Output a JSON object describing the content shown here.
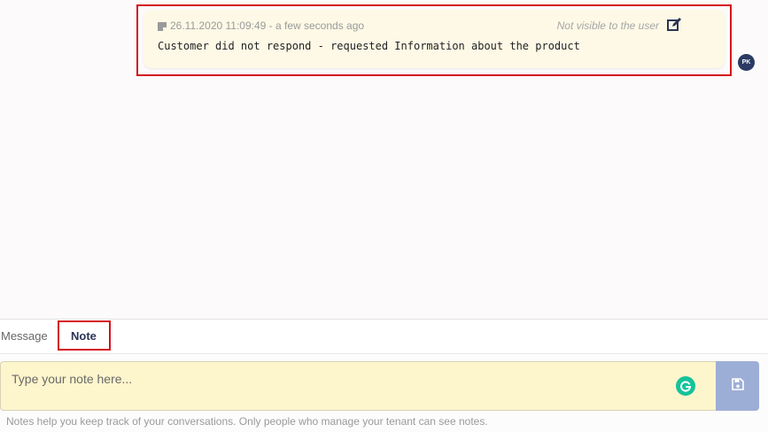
{
  "note": {
    "timestamp": "26.11.2020 11:09:49 - a few seconds ago",
    "visibility": "Not visible to the user",
    "text": "Customer did not respond - requested Information about the product",
    "author_initials": "PK"
  },
  "tabs": {
    "message": "Message",
    "note": "Note"
  },
  "composer": {
    "placeholder": "Type your note here..."
  },
  "help_text": "Notes help you keep track of your conversations. Only people who manage your tenant can see notes.",
  "colors": {
    "note_background": "#fdf9e6",
    "composer_background": "#fdf5cc",
    "save_button": "#9daed6",
    "highlight": "#d4131b",
    "avatar": "#2a3a63",
    "grammarly": "#15c39a"
  },
  "icons": {
    "note_meta": "note-icon",
    "edit": "edit-icon",
    "grammarly": "grammarly-icon",
    "save": "save-icon"
  }
}
